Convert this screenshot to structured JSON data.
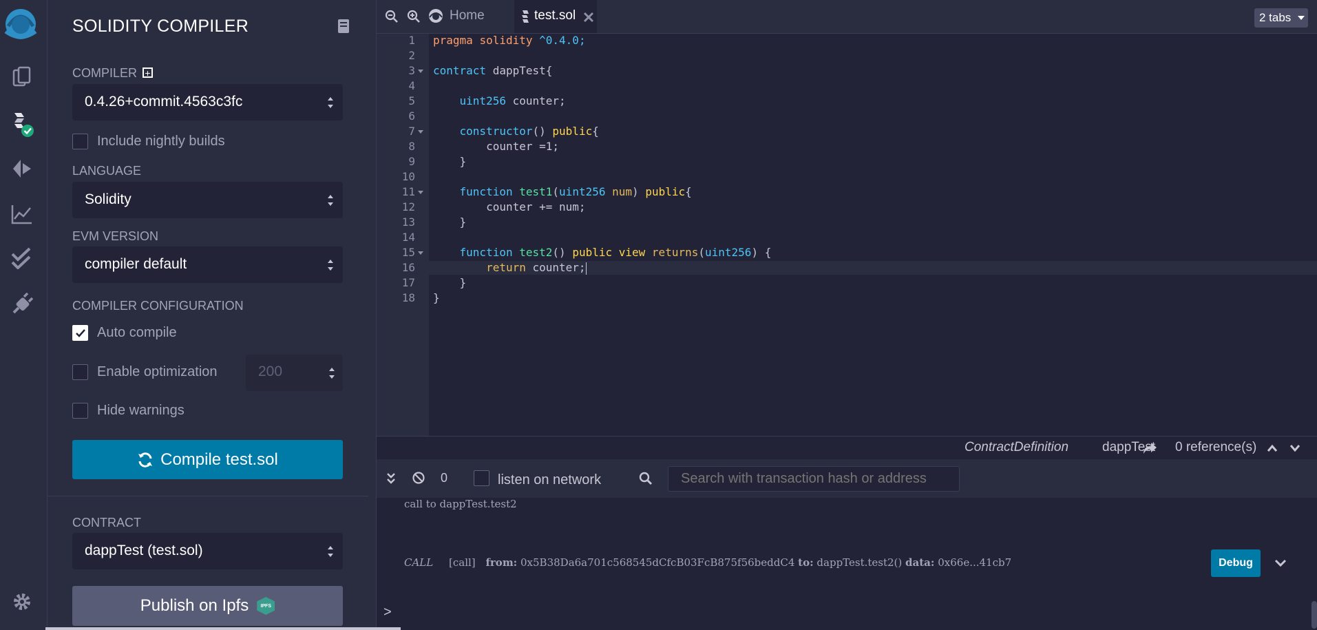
{
  "sidepanel": {
    "title": "SOLIDITY COMPILER",
    "compiler_label": "COMPILER",
    "compiler_value": "0.4.26+commit.4563c3fc",
    "nightly_label": "Include nightly builds",
    "language_label": "LANGUAGE",
    "language_value": "Solidity",
    "evm_label": "EVM VERSION",
    "evm_value": "compiler default",
    "config_label": "COMPILER CONFIGURATION",
    "auto_compile_label": "Auto compile",
    "optimization_label": "Enable optimization",
    "runs_value": "200",
    "hide_warnings_label": "Hide warnings",
    "compile_button": "Compile test.sol",
    "contract_label": "CONTRACT",
    "contract_value": "dappTest (test.sol)",
    "publish_button": "Publish on Ipfs",
    "ipfs_badge": "IPFS"
  },
  "tabs": {
    "home": "Home",
    "file": "test.sol",
    "count": "2 tabs"
  },
  "code_lines": [
    {
      "n": "1",
      "fold": false
    },
    {
      "n": "2",
      "fold": false
    },
    {
      "n": "3",
      "fold": true
    },
    {
      "n": "4",
      "fold": false
    },
    {
      "n": "5",
      "fold": false
    },
    {
      "n": "6",
      "fold": false
    },
    {
      "n": "7",
      "fold": true
    },
    {
      "n": "8",
      "fold": false
    },
    {
      "n": "9",
      "fold": false
    },
    {
      "n": "10",
      "fold": false
    },
    {
      "n": "11",
      "fold": true
    },
    {
      "n": "12",
      "fold": false
    },
    {
      "n": "13",
      "fold": false
    },
    {
      "n": "14",
      "fold": false
    },
    {
      "n": "15",
      "fold": true
    },
    {
      "n": "16",
      "fold": false
    },
    {
      "n": "17",
      "fold": false
    },
    {
      "n": "18",
      "fold": false
    }
  ],
  "code": {
    "l1a": "pragma",
    "l1b": "solidity",
    "l1c": "^0.4.0;",
    "l3a": "contract",
    "l3b": "dappTest{",
    "l5a": "uint256",
    "l5b": "counter;",
    "l7a": "constructor",
    "l7b": "()",
    "l7c": "public",
    "l7d": "{",
    "l8": "counter =1;",
    "l9": "}",
    "l11a": "function",
    "l11b": "test1",
    "l11c": "(",
    "l11d": "uint256",
    "l11e": "num",
    "l11f": ")",
    "l11g": "public",
    "l11h": "{",
    "l12": "counter += num;",
    "l13": "}",
    "l15a": "function",
    "l15b": "test2",
    "l15c": "()",
    "l15d": "public",
    "l15e": "view",
    "l15f": "returns",
    "l15g": "(",
    "l15h": "uint256",
    "l15i": ") {",
    "l16a": "return",
    "l16b": "counter;",
    "l17": "}",
    "l18": "}"
  },
  "status": {
    "def_type": "ContractDefinition",
    "def_name": "dappTest",
    "refs": "0 reference(s)"
  },
  "terminal": {
    "count": "0",
    "listen_label": "listen on network",
    "search_placeholder": "Search with transaction hash or address",
    "log1": "call to dappTest.test2",
    "call_tag": "CALL",
    "call_kind": "[call]",
    "from_label": "from:",
    "from_value": "0x5B38Da6a701c568545dCfcB03FcB875f56beddC4",
    "to_label": "to:",
    "to_value": "dappTest.test2()",
    "data_label": "data:",
    "data_value": "0x66e...41cb7",
    "debug_button": "Debug",
    "prompt": ">"
  },
  "colors": {
    "accent": "#007aa6",
    "bg": "#222336",
    "panel": "#2a2c3f",
    "success": "#1fa97a"
  }
}
